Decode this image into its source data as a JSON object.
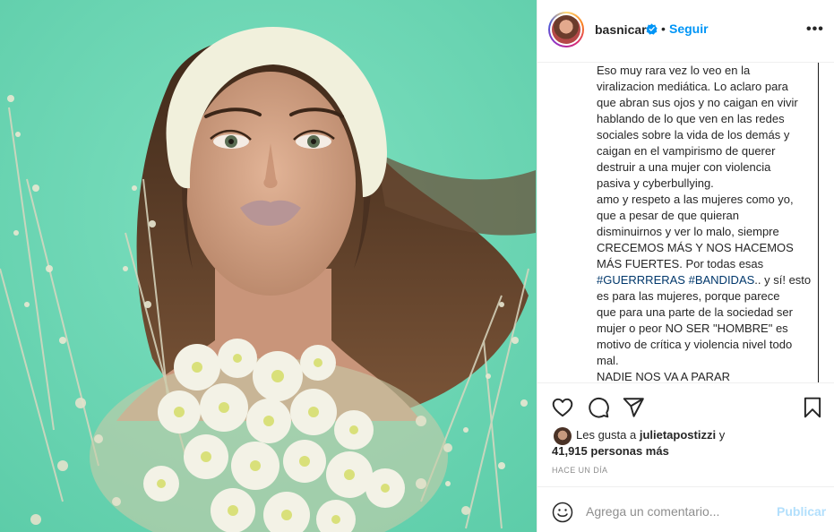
{
  "post": {
    "image_alt": "",
    "image_colors": {
      "background": "#6fd7b4",
      "headband": "#f1f0dc",
      "hair": "#4a3121",
      "skin": "#d7a788",
      "flowers": "#eef0e0"
    }
  },
  "header": {
    "username": "basnicar",
    "separator": "•",
    "follow_label": "Seguir",
    "more_label": "•••"
  },
  "caption": {
    "lines": [
      "Eso muy rara vez lo veo en la",
      "viralizacion mediática. Lo aclaro para",
      "que abran sus ojos y no caigan en vivir",
      "hablando de lo que ven en las redes",
      "sociales sobre la vida de los demás y",
      "caigan en el vampirismo de querer",
      "destruir a una mujer con violencia",
      "pasiva y cyberbullying.",
      "amo y respeto a las mujeres como yo,",
      "que a pesar de que quieran",
      "disminuirnos y ver lo malo, siempre",
      "CRECEMOS MÁS Y NOS HACEMOS",
      "MÁS FUERTES. Por todas esas"
    ],
    "hashtag_line": {
      "tag1": "#GUERRRERAS",
      "tag2": "#BANDIDAS",
      "rest": ".. y sí! esto"
    },
    "lines_after": [
      "es para las mujeres, porque parece",
      "que para una parte de la sociedad ser",
      "mujer o peor NO SER \"HOMBRE\" es",
      "motivo de crítica y violencia nivel todo",
      "mal.",
      "NADIE NOS VA A PARAR"
    ]
  },
  "actions": {
    "like_icon": "heart-icon",
    "comment_icon": "comment-icon",
    "share_icon": "paper-plane-icon",
    "save_icon": "bookmark-icon"
  },
  "likes": {
    "prefix": "Les gusta a",
    "user": "julietapostizzi",
    "conj": "y",
    "count": "41,915",
    "suffix": "personas más"
  },
  "timestamp": "HACE UN DÍA",
  "comment": {
    "placeholder": "Agrega un comentario...",
    "publish_label": "Publicar"
  },
  "colors": {
    "accent": "#0095f6",
    "publish_disabled": "#b2dffc",
    "hashtag": "#00376b"
  }
}
